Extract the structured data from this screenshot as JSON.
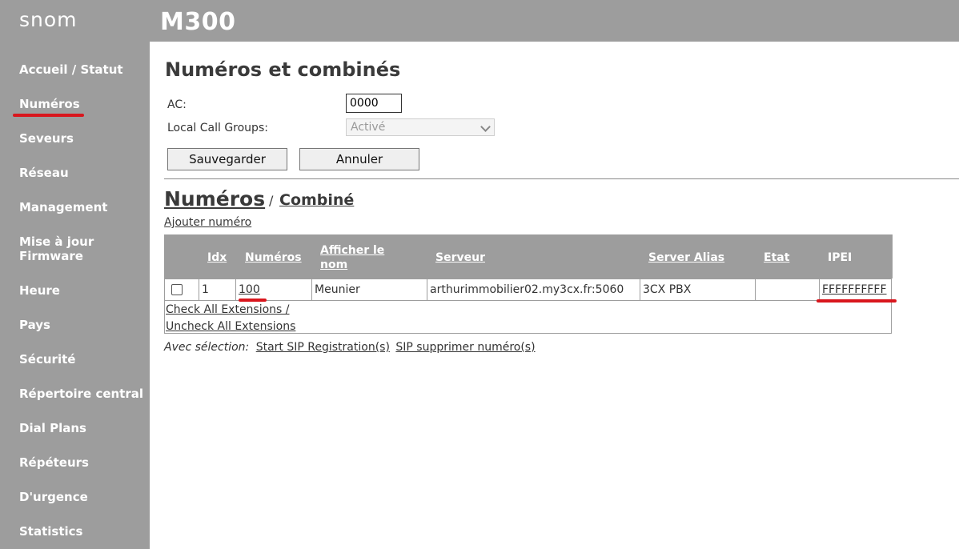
{
  "brand": {
    "logo": "snom",
    "model": "M300"
  },
  "sidebar": {
    "items": [
      {
        "label": "Accueil / Statut"
      },
      {
        "label": "Numéros"
      },
      {
        "label": "Seveurs"
      },
      {
        "label": "Réseau"
      },
      {
        "label": "Management"
      },
      {
        "label": "Mise à jour Firmware"
      },
      {
        "label": "Heure"
      },
      {
        "label": "Pays"
      },
      {
        "label": "Sécurité"
      },
      {
        "label": "Répertoire central"
      },
      {
        "label": "Dial Plans"
      },
      {
        "label": "Répéteurs"
      },
      {
        "label": "D'urgence"
      },
      {
        "label": "Statistics"
      }
    ],
    "active": "Numéros",
    "highlight_color": "#d9161d"
  },
  "page": {
    "title": "Numéros et combinés",
    "ac_label": "AC:",
    "ac_value": "0000",
    "local_call_groups_label": "Local Call Groups:",
    "local_call_groups_value": "Activé",
    "save_label": "Sauvegarder",
    "cancel_label": "Annuler"
  },
  "section": {
    "tab_numbers": "Numéros",
    "separator": "/",
    "tab_handset": "Combiné",
    "add_number": "Ajouter numéro"
  },
  "table": {
    "headers": [
      "Idx",
      "Numéros",
      "Afficher le nom",
      "Serveur",
      "Server Alias",
      "Etat",
      "IPEI"
    ],
    "rows": [
      {
        "idx": "1",
        "number": "100",
        "display_name": "Meunier",
        "server": "arthurimmobilier02.my3cx.fr:5060",
        "alias": "3CX PBX",
        "state": "",
        "ipei": "FFFFFFFFFF"
      }
    ],
    "check_all": "Check All Extensions /",
    "uncheck_all": "Uncheck All Extensions"
  },
  "selection": {
    "prefix": "Avec sélection:",
    "start_registration": "Start SIP Registration(s)",
    "delete_number": "SIP supprimer numéro(s)"
  },
  "colors": {
    "sidebar": "#9d9d9d",
    "accent": "#d9161d"
  }
}
